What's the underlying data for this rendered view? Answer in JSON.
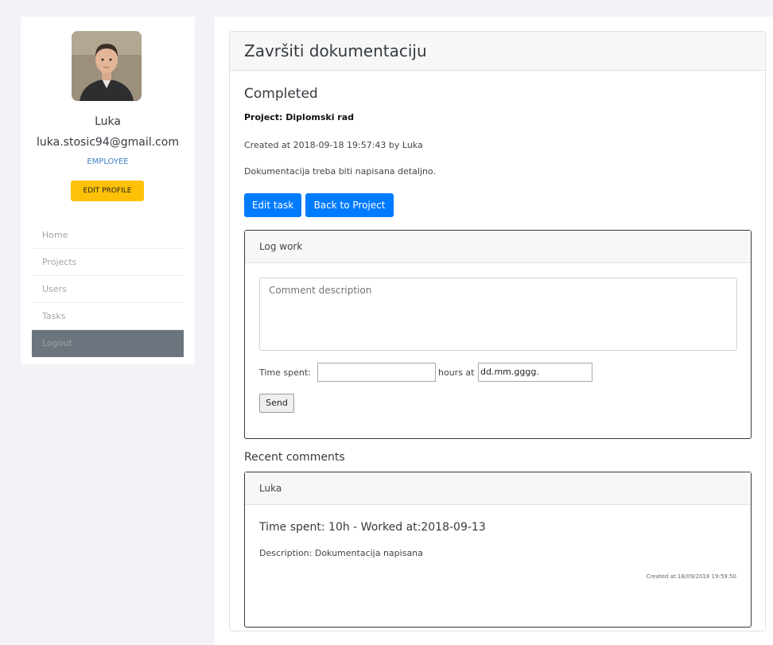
{
  "user": {
    "name": "Luka",
    "email": "luka.stosic94@gmail.com",
    "role": "EMPLOYEE",
    "edit_profile_label": "EDIT PROFILE"
  },
  "nav": {
    "items": [
      {
        "label": "Home"
      },
      {
        "label": "Projects"
      },
      {
        "label": "Users"
      },
      {
        "label": "Tasks"
      },
      {
        "label": "Logout",
        "active": true
      }
    ]
  },
  "task": {
    "title": "Završiti dokumentaciju",
    "status": "Completed",
    "project": "Project: Diplomski rad",
    "created": "Created at 2018-09-18 19:57:43 by Luka",
    "description": "Dokumentacija treba biti napisana detaljno.",
    "edit_label": "Edit task",
    "back_label": "Back to Project"
  },
  "log_work": {
    "title": "Log work",
    "comment_placeholder": "Comment description",
    "time_label": "Time spent:",
    "hours_label": "hours at",
    "date_placeholder": "dd.mm.gggg.",
    "send_label": "Send"
  },
  "recent": {
    "title": "Recent comments",
    "comments": [
      {
        "author": "Luka",
        "time": "Time spent: 10h - Worked at:2018-09-13",
        "description": "Description: Dokumentacija napisana",
        "created": "Created at:18/09/2018 19:59:50"
      }
    ]
  },
  "colors": {
    "primary": "#007bff",
    "warning": "#ffc107",
    "nav_active": "#6c757d",
    "role_text": "#3c7fc3"
  }
}
